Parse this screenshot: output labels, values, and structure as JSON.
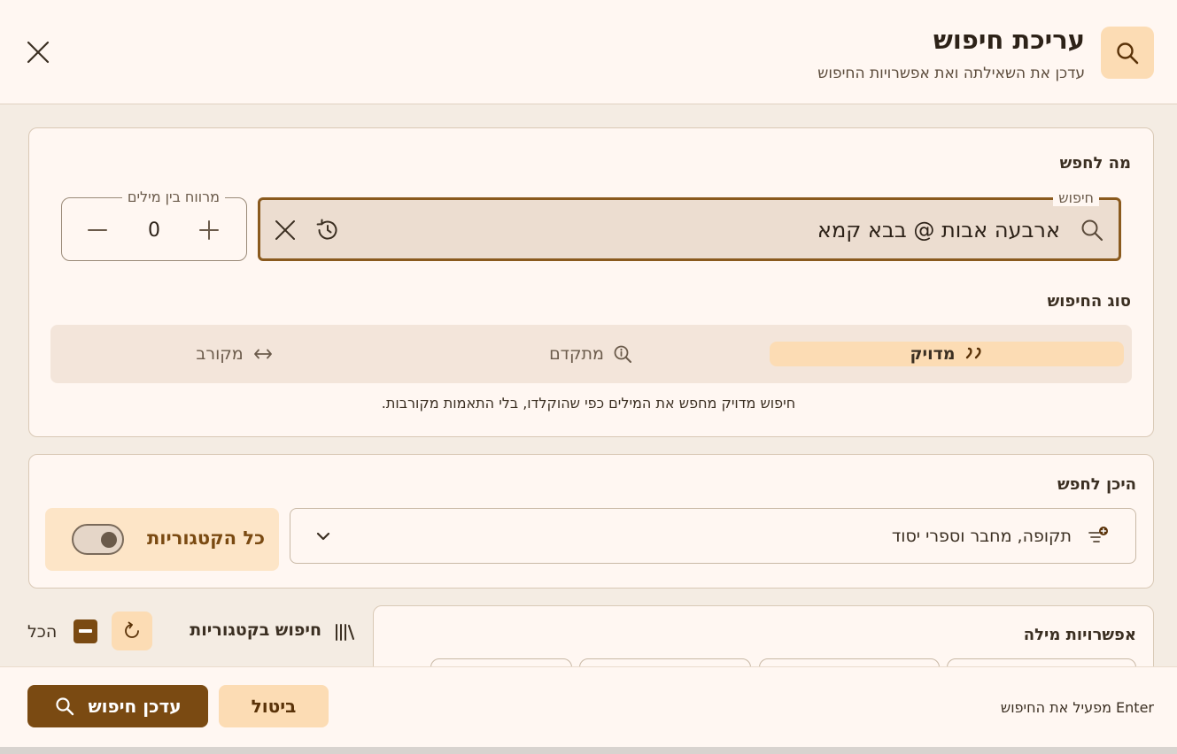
{
  "header": {
    "title": "עריכת חיפוש",
    "subtitle": "עדכן את השאילתה ואת אפשרויות החיפוש",
    "icon": "search-icon",
    "close_icon": "close-icon"
  },
  "what_to_search": {
    "label": "מה לחפש",
    "search_field": {
      "legend": "חיפוש",
      "value": "ארבעה אבות @ בבא קמא"
    },
    "distance": {
      "legend": "מרווח בין מילים",
      "value": "0"
    },
    "search_type": {
      "label": "סוג החיפוש",
      "options": [
        {
          "label": "מדויק",
          "icon": "quote-icon",
          "active": true
        },
        {
          "label": "מתקדם",
          "icon": "info-search-icon",
          "active": false
        },
        {
          "label": "מקורב",
          "icon": "arrows-horizontal-icon",
          "active": false
        }
      ],
      "description": "חיפוש מדויק מחפש את המילים כפי שהוקלדו, בלי התאמות מקורבות."
    }
  },
  "where_to_search": {
    "label": "היכן לחפש",
    "dropdown_value": "תקופה, מחבר וספרי יסוד",
    "toggle_label": "כל הקטגוריות",
    "toggle_on": true
  },
  "categories": {
    "label": "חיפוש בקטגוריות",
    "all_label": "הכל"
  },
  "word_options": {
    "label": "אפשרויות מילה"
  },
  "footer": {
    "primary_label": "עדכן חיפוש",
    "secondary_label": "ביטול",
    "hint": "Enter מפעיל את החיפוש"
  },
  "colors": {
    "accent": "#7a4a12",
    "accent_light": "#fcdcb4",
    "background": "#fff7f2",
    "panel": "#f4ece3"
  }
}
